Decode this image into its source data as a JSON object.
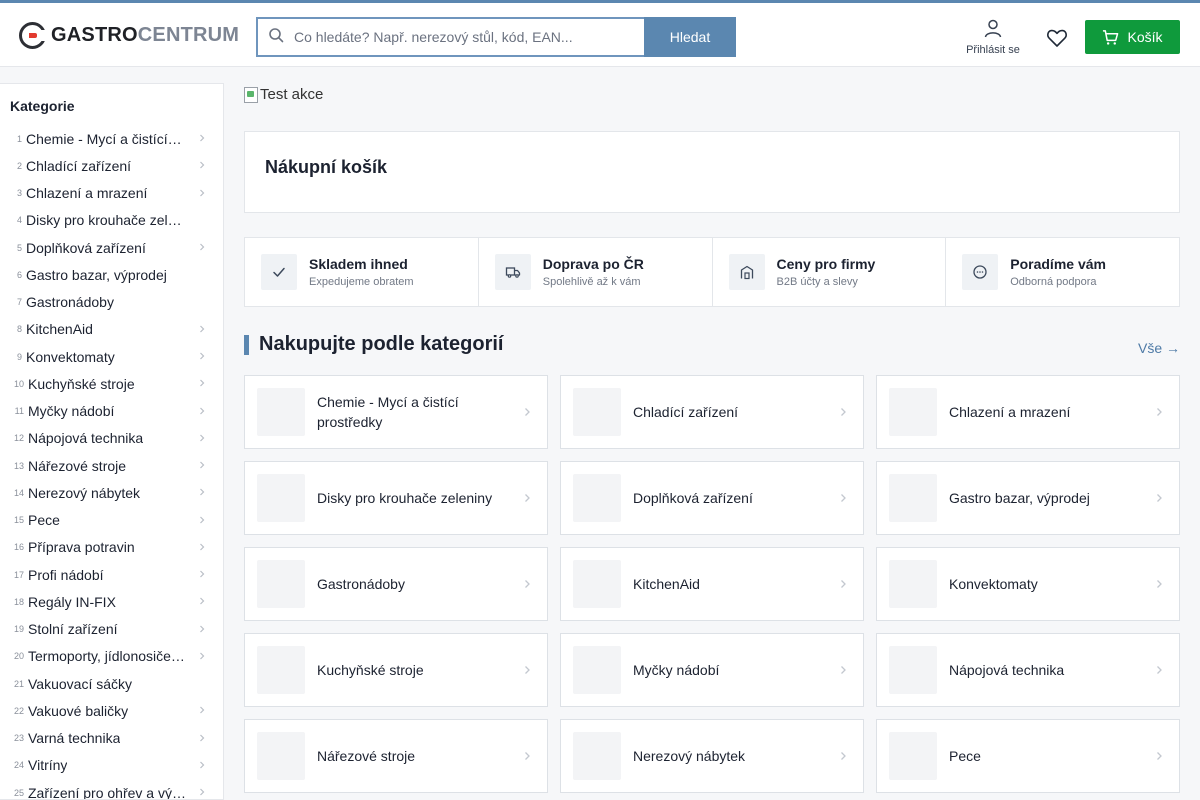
{
  "header": {
    "logo_part1": "GASTRO",
    "logo_part2": "CENTRUM",
    "search_placeholder": "Co hledáte? Např. nerezový stůl, kód, EAN...",
    "search_button": "Hledat",
    "login_label": "Přihlásit se",
    "cart_label": "Košík"
  },
  "sidebar": {
    "title": "Kategorie",
    "items": [
      {
        "num": "1",
        "label": "Chemie - Mycí a čistící prostředky",
        "chevron": true
      },
      {
        "num": "2",
        "label": "Chladící zařízení",
        "chevron": true
      },
      {
        "num": "3",
        "label": "Chlazení a mrazení",
        "chevron": true
      },
      {
        "num": "4",
        "label": "Disky pro krouhače zeleniny",
        "chevron": false
      },
      {
        "num": "5",
        "label": "Doplňková zařízení",
        "chevron": true
      },
      {
        "num": "6",
        "label": "Gastro bazar, výprodej",
        "chevron": false
      },
      {
        "num": "7",
        "label": "Gastronádoby",
        "chevron": false
      },
      {
        "num": "8",
        "label": "KitchenAid",
        "chevron": true
      },
      {
        "num": "9",
        "label": "Konvektomaty",
        "chevron": true
      },
      {
        "num": "10",
        "label": "Kuchyňské stroje",
        "chevron": true
      },
      {
        "num": "11",
        "label": "Myčky nádobí",
        "chevron": true
      },
      {
        "num": "12",
        "label": "Nápojová technika",
        "chevron": true
      },
      {
        "num": "13",
        "label": "Nářezové stroje",
        "chevron": true
      },
      {
        "num": "14",
        "label": "Nerezový nábytek",
        "chevron": true
      },
      {
        "num": "15",
        "label": "Pece",
        "chevron": true
      },
      {
        "num": "16",
        "label": "Příprava potravin",
        "chevron": true
      },
      {
        "num": "17",
        "label": "Profi nádobí",
        "chevron": true
      },
      {
        "num": "18",
        "label": "Regály IN-FIX",
        "chevron": true
      },
      {
        "num": "19",
        "label": "Stolní zařízení",
        "chevron": true
      },
      {
        "num": "20",
        "label": "Termoporty, jídlonosiče a výdej",
        "chevron": true
      },
      {
        "num": "21",
        "label": "Vakuovací sáčky",
        "chevron": false
      },
      {
        "num": "22",
        "label": "Vakuové baličky",
        "chevron": true
      },
      {
        "num": "23",
        "label": "Varná technika",
        "chevron": true
      },
      {
        "num": "24",
        "label": "Vitríny",
        "chevron": true
      },
      {
        "num": "25",
        "label": "Zařízení pro ohřev a výdej",
        "chevron": true
      }
    ]
  },
  "promo": {
    "alt": "Test akce"
  },
  "cart_panel": {
    "title": "Nákupní košík"
  },
  "benefits": [
    {
      "icon": "check-icon",
      "title": "Skladem ihned",
      "subtitle": "Expedujeme obratem"
    },
    {
      "icon": "truck-icon",
      "title": "Doprava po ČR",
      "subtitle": "Spolehlivě až k vám"
    },
    {
      "icon": "building-icon",
      "title": "Ceny pro firmy",
      "subtitle": "B2B účty a slevy"
    },
    {
      "icon": "chat-icon",
      "title": "Poradíme vám",
      "subtitle": "Odborná podpora"
    }
  ],
  "categories_section": {
    "title": "Nakupujte podle kategorií",
    "all_link": "Vše →",
    "cards": [
      "Chemie - Mycí a čistící prostředky",
      "Chladící zařízení",
      "Chlazení a mrazení",
      "Disky pro krouhače zeleniny",
      "Doplňková zařízení",
      "Gastro bazar, výprodej",
      "Gastronádoby",
      "KitchenAid",
      "Konvektomaty",
      "Kuchyňské stroje",
      "Myčky nádobí",
      "Nápojová technika",
      "Nářezové stroje",
      "Nerezový nábytek",
      "Pece"
    ]
  },
  "colors": {
    "accent": "#5b87b0",
    "cart_green": "#0f9a3c",
    "logo_red": "#e23a2f"
  }
}
